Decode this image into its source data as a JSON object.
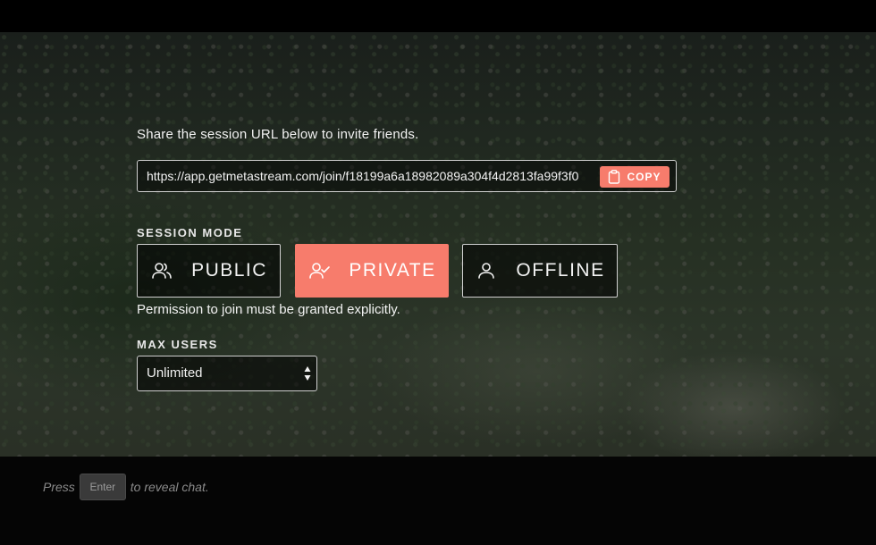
{
  "invite": {
    "instruction": "Share the session URL below to invite friends.",
    "url": "https://app.getmetastream.com/join/f18199a6a18982089a304f4d2813fa99f3f0",
    "copy_label": "COPY"
  },
  "session_mode": {
    "label": "SESSION MODE",
    "options": [
      {
        "label": "PUBLIC",
        "icon": "users-icon"
      },
      {
        "label": "PRIVATE",
        "icon": "user-check-icon"
      },
      {
        "label": "OFFLINE",
        "icon": "user-icon"
      }
    ],
    "selected": "PRIVATE",
    "description": "Permission to join must be granted explicitly."
  },
  "max_users": {
    "label": "MAX USERS",
    "selected": "Unlimited"
  },
  "chat_hint": {
    "prefix": "Press",
    "key": "Enter",
    "suffix": "to reveal chat."
  },
  "colors": {
    "accent": "#f77c6c",
    "background": "#000000"
  }
}
